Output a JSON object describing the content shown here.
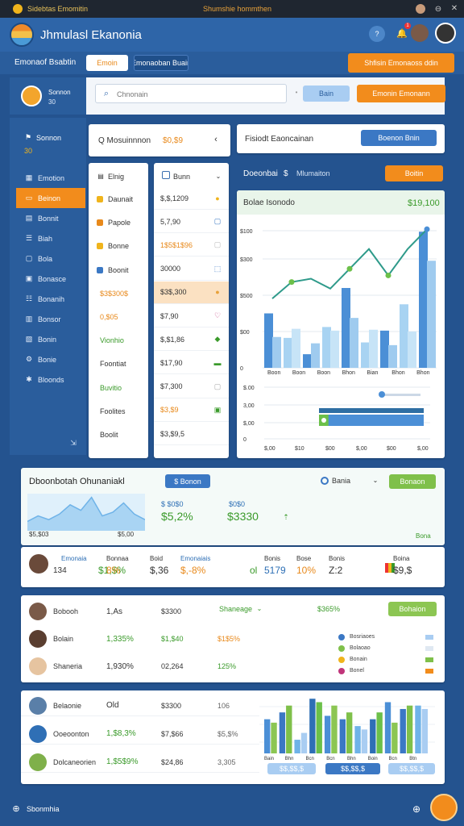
{
  "titlebar": {
    "app": "Sidebtas Emomitin",
    "center": "Shumshie hommthen"
  },
  "header": {
    "title": "Jhmulasl Ekanonia",
    "badge": "1"
  },
  "subbar": {
    "label": "Emonaof Bsabtin",
    "tab_active": "Emoin",
    "tab2": "Emonaoban Buain",
    "right_button": "Shfisin Emonaoss ddin"
  },
  "search": {
    "placeholder": "Chnonain",
    "dropdown": "Bain",
    "action": "Emonin Emonann"
  },
  "sidebar": {
    "header": "Sonnon",
    "sub": "30",
    "items": [
      {
        "label": "Emotion",
        "icon": "grid-icon"
      },
      {
        "label": "Beinon",
        "icon": "folder-icon"
      },
      {
        "label": "Bonnit",
        "icon": "chart-icon"
      },
      {
        "label": "Biah",
        "icon": "list-icon"
      },
      {
        "label": "Bola",
        "icon": "doc-icon"
      },
      {
        "label": "Bonasce",
        "icon": "calendar-icon"
      },
      {
        "label": "Bonanih",
        "icon": "people-icon"
      },
      {
        "label": "Bonsor",
        "icon": "report-icon"
      },
      {
        "label": "Bonin",
        "icon": "box-icon"
      },
      {
        "label": "Bonie",
        "icon": "settings-icon"
      },
      {
        "label": "Bloonds",
        "icon": "gear-icon"
      }
    ]
  },
  "panel_left": {
    "header": "Q Mosuinnnon",
    "header_value": "$0,$9",
    "list_header": "Elnig",
    "col2_header": "Bunn",
    "rows": [
      {
        "label": "Daunait",
        "value": "$,$,1209"
      },
      {
        "label": "Papole",
        "value": "5,7,90"
      },
      {
        "label": "Bonne",
        "value": "1$5$1$96"
      },
      {
        "label": "Boonit",
        "value": "30000"
      },
      {
        "label": "$3$300$",
        "value": "$3$,300"
      },
      {
        "label": "0,$05",
        "value": "$7,90"
      },
      {
        "label": "Vionhio",
        "value": "$,$1,86"
      },
      {
        "label": "Foontiat",
        "value": "$17,90"
      },
      {
        "label": "Buvitio",
        "value": "$7,300"
      },
      {
        "label": "Foolites",
        "value": "$3,$9"
      },
      {
        "label": "Boolit",
        "value": "$3,$9,5"
      }
    ]
  },
  "panel_right": {
    "header": "Fisiodt Eaoncainan",
    "header_button": "Boenon Bnin",
    "sub_label": "Doeonbai",
    "sub_value": "$",
    "sub_text": "Mlumaiton",
    "sub_button": "Boitin",
    "chart_title": "Bolae Isonodo",
    "chart_value": "$19,100"
  },
  "chart_data": [
    {
      "type": "bar",
      "title": "Bolae Isonodo",
      "yticks": [
        "$100",
        "$300",
        "$500",
        "$00",
        "0"
      ],
      "categories": [
        "Boon",
        "Boon",
        "Boon",
        "Bhon",
        "Bian",
        "Bhon",
        "Bhon"
      ],
      "series": [
        {
          "values": [
            60,
            33,
            15,
            45,
            88,
            28,
            41,
            70,
            150
          ]
        },
        {
          "values": [
            34,
            43,
            27,
            41,
            55,
            42,
            25,
            40,
            118
          ]
        }
      ],
      "line": [
        210,
        260,
        270,
        240,
        300,
        360,
        280,
        360,
        420
      ]
    },
    {
      "type": "line",
      "title": "Dboonbotah Ohunaniakl",
      "values": [
        5,
        8,
        6,
        9,
        14,
        11,
        18,
        8,
        10,
        15,
        9,
        6
      ]
    },
    {
      "type": "bar",
      "categories": [
        "Bain",
        "Bhn",
        "Bcn",
        "Bcn",
        "Bhn",
        "Boin",
        "Bcn",
        "Btn"
      ],
      "series": [
        {
          "values": [
            20,
            24,
            8,
            32,
            22,
            20,
            16,
            20,
            30,
            26,
            28
          ]
        },
        {
          "values": [
            18,
            28,
            12,
            30,
            28,
            24,
            14,
            24,
            18,
            28,
            26
          ]
        }
      ]
    }
  ],
  "chart_small": {
    "yticks": [
      "$.00",
      "3,00",
      "$,00",
      "0"
    ],
    "xticks": [
      "$,00",
      "$10",
      "$00",
      "$,00",
      "$00",
      "$,00"
    ],
    "bars": [
      0.45,
      0.8,
      0.3
    ]
  },
  "mid_card": {
    "title": "Dboonbotah Ohunaniakl",
    "button": "$ Bonon",
    "dropdown": "Bania",
    "green_button": "Bonaon",
    "stat1_label": "$ $0$0",
    "stat1_value": "$5,2%",
    "stat2_label": "$0$0",
    "stat2_value": "$3330",
    "low_left": "$5,$03",
    "low_mid": "$5,00",
    "low_right": "Bona",
    "stats_row": [
      {
        "h": "Emonaia",
        "v": "$1,$%",
        "c": "green"
      },
      {
        "h": "Bonnaa",
        "v": "8%",
        "c": "orange"
      },
      {
        "h": "Boid",
        "v": "$,36",
        "c": "dark"
      },
      {
        "h": "Emonaiais",
        "v": "$,-8%",
        "c": "orange"
      },
      {
        "h": "",
        "v": "ol",
        "c": "green"
      },
      {
        "h": "Bonis",
        "v": "5179",
        "c": "blue"
      },
      {
        "h": "Bose",
        "v": "10%",
        "c": "orange"
      },
      {
        "h": "Bonis",
        "v": "Z:2",
        "c": "dark"
      },
      {
        "h": "",
        "v": "",
        "c": "flag"
      },
      {
        "h": "Boina",
        "v": "$9,$",
        "c": "dark"
      }
    ],
    "person_value": "134"
  },
  "list1": {
    "dropdown": "Shaneage",
    "dropdown_value": "$365%",
    "right_button": "Bohaion",
    "rows": [
      {
        "name": "Bobooh",
        "a": "1,As",
        "b": "$3300",
        "c": "",
        "ac": "dark"
      },
      {
        "name": "Bolain",
        "a": "1,335%",
        "b": "$1,$40",
        "c": "$1$5%",
        "ac": "green"
      },
      {
        "name": "Shaneria",
        "a": "1,930%",
        "b": "02,264",
        "c": "125%",
        "ac": "dark"
      }
    ],
    "legend": [
      {
        "label": "Bosriaoes",
        "color": "#3b78c4"
      },
      {
        "label": "Bolaoao",
        "color": "#7fc04a"
      },
      {
        "label": "Bonain",
        "color": "#f0b41c"
      },
      {
        "label": "Bonel",
        "color": "#c0357a"
      }
    ]
  },
  "list2": {
    "rows": [
      {
        "name": "Belaonie",
        "a": "Old",
        "b": "$3300",
        "c": "106"
      },
      {
        "name": "Ooeoonton",
        "a": "1,$8,3%",
        "b": "$7,$66",
        "c": "$5,$%"
      },
      {
        "name": "Dolcaneorien",
        "a": "1,$5$9%",
        "b": "$24,86",
        "c": "3,305"
      }
    ],
    "footer_buttons": [
      "$$,$$,$",
      "$$,$$,$",
      "$$,$$,$"
    ]
  },
  "footer": {
    "label": "Sbonmhia"
  },
  "colors": {
    "accent": "#f28c1c",
    "blue": "#2b6cb8",
    "green": "#63b83e"
  }
}
